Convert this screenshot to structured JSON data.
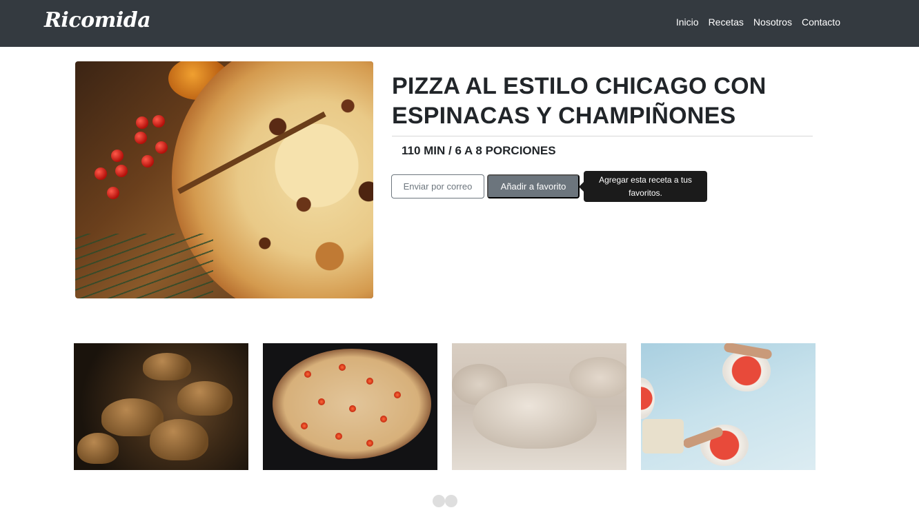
{
  "brand": "Ricomida",
  "nav": {
    "items": [
      {
        "label": "Inicio"
      },
      {
        "label": "Recetas"
      },
      {
        "label": "Nosotros"
      },
      {
        "label": "Contacto"
      }
    ]
  },
  "recipe": {
    "title": "PIZZA AL ESTILO CHICAGO CON ESPINACAS Y CHAMPIÑONES",
    "meta": "110 MIN / 6 A 8 PORCIONES",
    "email_button": "Enviar por correo",
    "favorite_button": "Añadir a favorito",
    "favorite_tooltip": "Agregar esta receta a tus favoritos."
  },
  "gallery": {
    "images": [
      {
        "subject": "mushrooms"
      },
      {
        "subject": "tomato pizza"
      },
      {
        "subject": "dough"
      },
      {
        "subject": "pizza preparation"
      }
    ],
    "dots": 2
  },
  "colors": {
    "navbar": "#343a40",
    "secondary": "#6c757d",
    "tooltip": "#1b1b1b"
  }
}
